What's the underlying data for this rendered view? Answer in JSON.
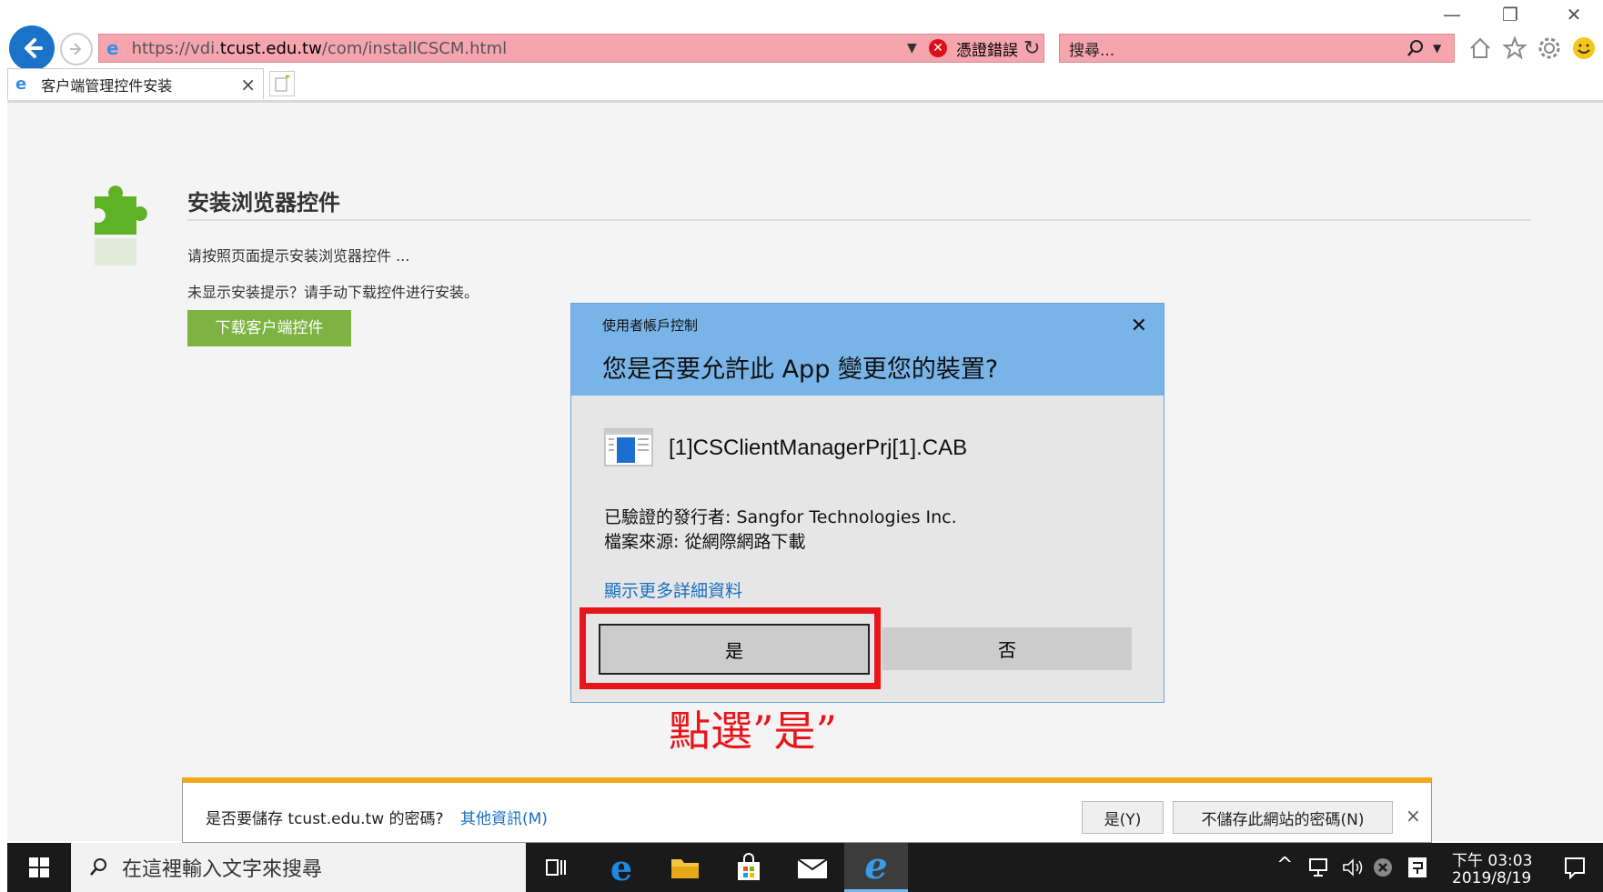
{
  "window": {
    "minimize": "—",
    "restore": "❐",
    "close": "✕"
  },
  "address_bar": {
    "url_prefix": "https://vdi.",
    "url_domain": "tcust.edu.tw",
    "url_path": "/com/installCSCM.html",
    "cert_error": "憑證錯誤"
  },
  "search_bar": {
    "placeholder": "搜尋..."
  },
  "tab": {
    "title": "客户端管理控件安装",
    "close": "×"
  },
  "page": {
    "heading": "安装浏览器控件",
    "instruction": "请按照页面提示安装浏览器控件 ...",
    "manual_hint": "未显示安装提示？请手动下载控件进行安装。",
    "download_button": "下载客户端控件"
  },
  "uac_dialog": {
    "caption": "使用者帳戶控制",
    "question": "您是否要允許此 App 變更您的裝置?",
    "file_name": "[1]CSClientManagerPrj[1].CAB",
    "publisher": "已驗證的發行者: Sangfor Technologies Inc.",
    "origin": "檔案來源: 從網際網路下載",
    "more_details": "顯示更多詳細資料",
    "yes_button": "是",
    "no_button": "否",
    "close": "✕"
  },
  "annotation": {
    "text": "點選”是”",
    "color": "#e8151b"
  },
  "password_bar": {
    "prompt": "是否要儲存 tcust.edu.tw 的密碼?",
    "more_info": "其他資訊(M)",
    "yes_button": "是(Y)",
    "never_button": "不儲存此網站的密碼(N)",
    "close": "×"
  },
  "taskbar": {
    "search_placeholder": "在這裡輸入文字來搜尋",
    "time": "下午 03:03",
    "date": "2019/8/19"
  },
  "colors": {
    "accent": "#1a73c8",
    "dialog_header": "#78b4e8",
    "download_button": "#7cb342",
    "annotation_box": "#e8151b"
  }
}
